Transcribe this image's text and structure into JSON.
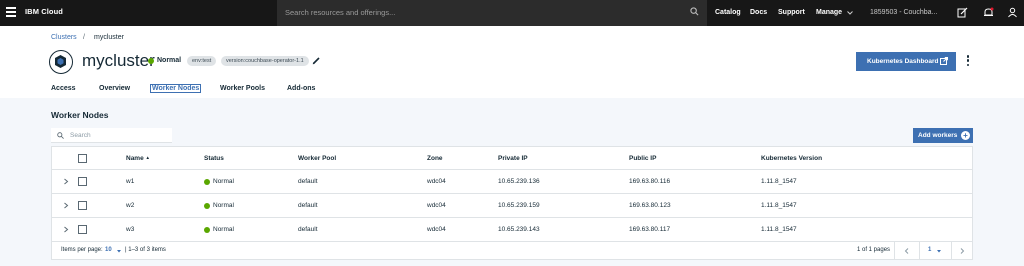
{
  "topnav": {
    "brand": "IBM Cloud",
    "search_placeholder": "Search resources and offerings...",
    "links": [
      "Catalog",
      "Docs",
      "Support",
      "Manage"
    ],
    "account": "1859503 - Couchba..."
  },
  "breadcrumb": {
    "parent": "Clusters",
    "separator": "/",
    "current": "mycluster"
  },
  "cluster": {
    "name": "mycluster",
    "status": "Normal",
    "tags": [
      "env:test",
      "version:couchbase-operator-1.1"
    ]
  },
  "actions": {
    "dashboard_button": "Kubernetes Dashboard"
  },
  "tabs": [
    {
      "label": "Access",
      "active": false
    },
    {
      "label": "Overview",
      "active": false
    },
    {
      "label": "Worker Nodes",
      "active": true
    },
    {
      "label": "Worker Pools",
      "active": false
    },
    {
      "label": "Add-ons",
      "active": false
    }
  ],
  "section": {
    "title": "Worker Nodes",
    "search_placeholder": "Search",
    "add_button": "Add workers"
  },
  "table": {
    "columns": [
      "Name",
      "Status",
      "Worker Pool",
      "Zone",
      "Private IP",
      "Public IP",
      "Kubernetes Version"
    ],
    "sort_indicator": "▲",
    "rows": [
      {
        "name": "w1",
        "status": "Normal",
        "pool": "default",
        "zone": "wdc04",
        "private_ip": "10.65.239.136",
        "public_ip": "169.63.80.116",
        "version": "1.11.8_1547"
      },
      {
        "name": "w2",
        "status": "Normal",
        "pool": "default",
        "zone": "wdc04",
        "private_ip": "10.65.239.159",
        "public_ip": "169.63.80.123",
        "version": "1.11.8_1547"
      },
      {
        "name": "w3",
        "status": "Normal",
        "pool": "default",
        "zone": "wdc04",
        "private_ip": "10.65.239.143",
        "public_ip": "169.63.80.117",
        "version": "1.11.8_1547"
      }
    ]
  },
  "pagination": {
    "items_per_page_label": "Items per page:",
    "items_per_page": "10",
    "range": "| 1–3 of 3 items",
    "pages_label": "1 of 1 pages",
    "current_page": "1"
  },
  "colors": {
    "accent": "#3d70b2",
    "nav_bg": "#171717",
    "status_ok": "#5aa700",
    "page_bg": "#f4f7fb"
  }
}
